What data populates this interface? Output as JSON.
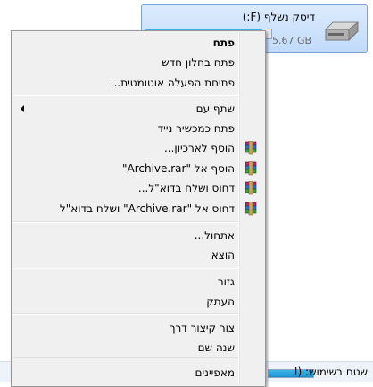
{
  "drive": {
    "title": "דיסק נשלף (F:)",
    "free_text": "5.67 GB",
    "usage_fraction": 0.93
  },
  "status": {
    "label": "שטח בשימוש: (I"
  },
  "menu": {
    "items": [
      {
        "label": "פתח",
        "bold": true
      },
      {
        "label": "פתח בחלון חדש"
      },
      {
        "label": "פתיחת הפעלה אוטומטית..."
      },
      {
        "label": "שתף עם",
        "submenu": true
      },
      {
        "label": "פתח כמכשיר נייד"
      },
      {
        "label": "הוסף לארכיון...",
        "icon": "winrar-icon"
      },
      {
        "label": "הוסף אל \"Archive.rar\"",
        "icon": "winrar-icon"
      },
      {
        "label": "דחוס ושלח בדוא\"ל...",
        "icon": "winrar-icon"
      },
      {
        "label": "דחוס אל \"Archive.rar\" ושלח בדוא\"ל",
        "icon": "winrar-icon"
      },
      {
        "label": "אתחול..."
      },
      {
        "label": "הוצא"
      },
      {
        "label": "גזור"
      },
      {
        "label": "העתק"
      },
      {
        "label": "צור קיצור דרך"
      },
      {
        "label": "שנה שם"
      },
      {
        "label": "מאפיינים"
      }
    ]
  }
}
